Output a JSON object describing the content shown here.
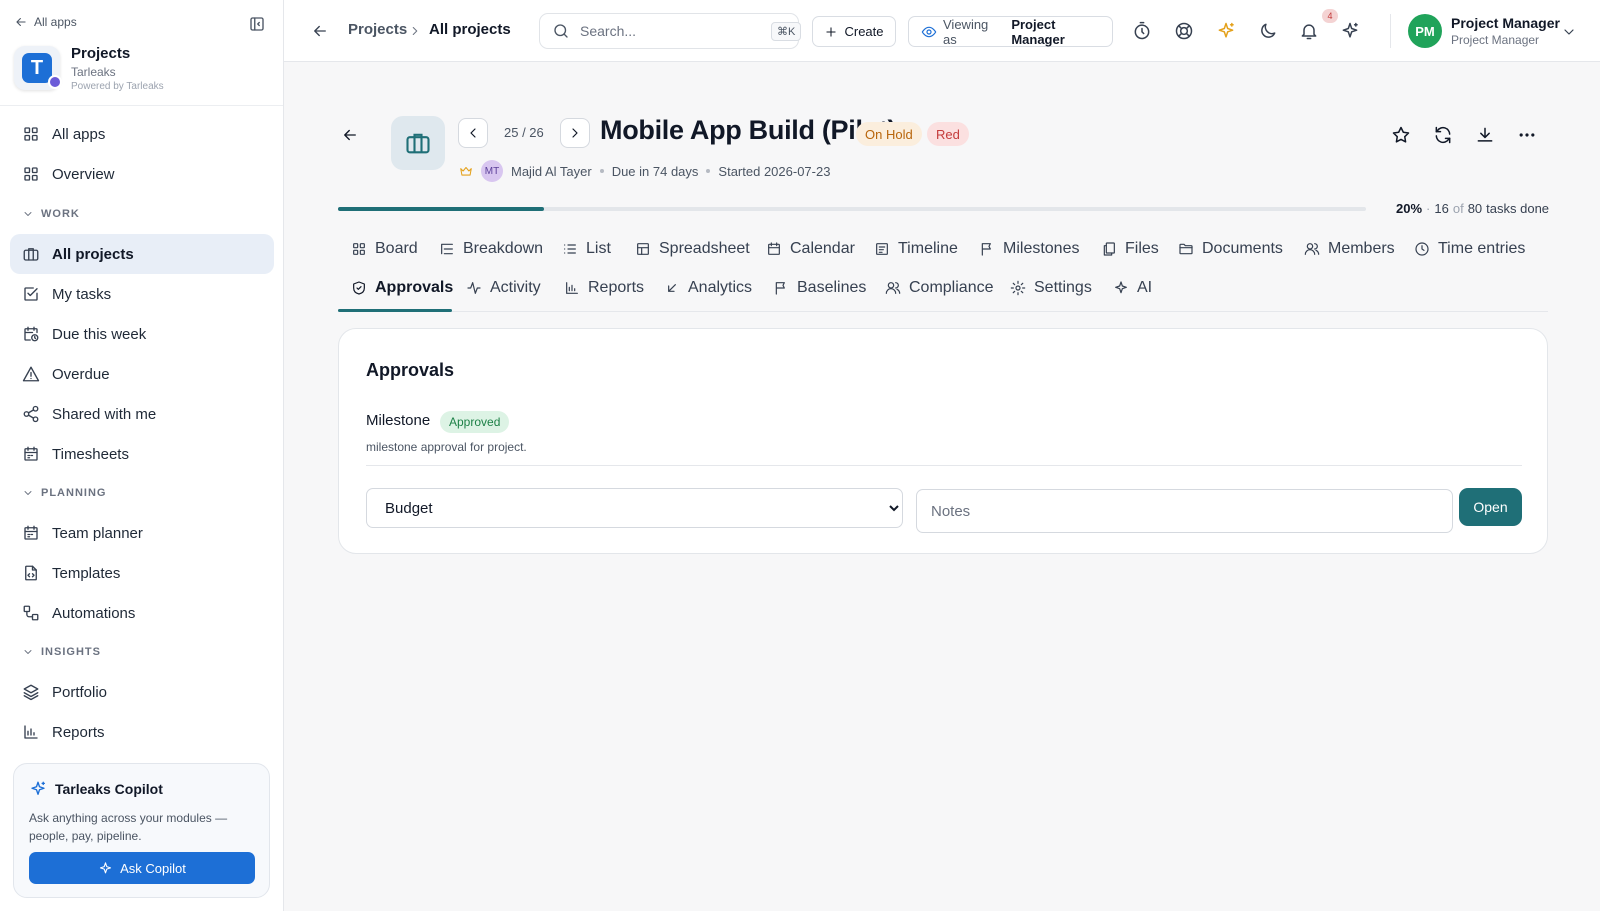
{
  "sidebar": {
    "back_label": "All apps",
    "app": {
      "name": "Projects",
      "org": "Tarleaks",
      "powered": "Powered by Tarleaks",
      "logo_letter": "T"
    },
    "items_top": [
      {
        "label": "All apps",
        "icon": "grid-icon"
      },
      {
        "label": "Overview",
        "icon": "grid-icon"
      }
    ],
    "sections": {
      "work": "WORK",
      "planning": "PLANNING",
      "insights": "INSIGHTS"
    },
    "work_items": [
      {
        "label": "All projects",
        "icon": "briefcase-icon",
        "active": true
      },
      {
        "label": "My tasks",
        "icon": "checkbox-icon"
      },
      {
        "label": "Due this week",
        "icon": "calendar-clock-icon"
      },
      {
        "label": "Overdue",
        "icon": "warning-icon"
      },
      {
        "label": "Shared with me",
        "icon": "share-icon"
      },
      {
        "label": "Timesheets",
        "icon": "calendar-icon"
      }
    ],
    "planning_items": [
      {
        "label": "Team planner",
        "icon": "calendar-icon"
      },
      {
        "label": "Templates",
        "icon": "file-icon"
      },
      {
        "label": "Automations",
        "icon": "workflow-icon"
      }
    ],
    "insights_items": [
      {
        "label": "Portfolio",
        "icon": "layers-icon"
      },
      {
        "label": "Reports",
        "icon": "bar-chart-icon"
      }
    ],
    "copilot": {
      "title": "Tarleaks Copilot",
      "description": "Ask anything across your modules — people, pay, pipeline.",
      "button": "Ask Copilot"
    }
  },
  "topbar": {
    "breadcrumb": [
      "Projects",
      "All projects"
    ],
    "search_placeholder": "Search...",
    "search_shortcut": "⌘K",
    "create_label": "Create",
    "viewing_label": "Viewing as",
    "viewing_role": "Project Manager",
    "notification_count": "4",
    "user": {
      "initials": "PM",
      "name": "Project Manager",
      "role": "Project Manager"
    }
  },
  "project": {
    "pager": "25 / 26",
    "title": "Mobile App Build (Pilot)",
    "status": "On Hold",
    "health": "Red",
    "owner_initials": "MT",
    "owner": "Majid Al Tayer",
    "due": "Due in 74 days",
    "started": "Started 2026-07-23",
    "progress_fraction": 0.2,
    "progress_pct": "20%",
    "progress_sep": "·",
    "tasks_done": "16",
    "tasks_of": "of",
    "tasks_total": "80",
    "tasks_suffix": "tasks done"
  },
  "tabs_row1": [
    {
      "label": "Board",
      "icon": "board-icon"
    },
    {
      "label": "Breakdown",
      "icon": "breakdown-icon"
    },
    {
      "label": "List",
      "icon": "list-icon"
    },
    {
      "label": "Spreadsheet",
      "icon": "table-icon"
    },
    {
      "label": "Calendar",
      "icon": "calendar-icon"
    },
    {
      "label": "Timeline",
      "icon": "timeline-icon"
    },
    {
      "label": "Milestones",
      "icon": "flag-icon"
    },
    {
      "label": "Files",
      "icon": "files-icon"
    },
    {
      "label": "Documents",
      "icon": "folder-icon"
    },
    {
      "label": "Members",
      "icon": "users-icon"
    },
    {
      "label": "Time entries",
      "icon": "clock-icon"
    }
  ],
  "tabs_row2": [
    {
      "label": "Approvals",
      "icon": "shield-check-icon",
      "active": true
    },
    {
      "label": "Activity",
      "icon": "activity-icon"
    },
    {
      "label": "Reports",
      "icon": "bar-chart-icon"
    },
    {
      "label": "Analytics",
      "icon": "arrow-down-left-icon"
    },
    {
      "label": "Baselines",
      "icon": "flag-icon"
    },
    {
      "label": "Compliance",
      "icon": "users-icon"
    },
    {
      "label": "Settings",
      "icon": "gear-icon"
    },
    {
      "label": "AI",
      "icon": "sparkles-icon"
    }
  ],
  "approvals": {
    "title": "Approvals",
    "item": {
      "name": "Milestone",
      "status": "Approved",
      "description": "milestone approval for project."
    },
    "select_value": "Budget",
    "select_options": [
      "Budget"
    ],
    "notes_placeholder": "Notes",
    "open_label": "Open"
  },
  "colors": {
    "accent": "#1f6f77",
    "primary": "#1d6fd6",
    "on_hold": "#b8650b",
    "red": "#c43c3c",
    "approved": "#1d8147"
  }
}
